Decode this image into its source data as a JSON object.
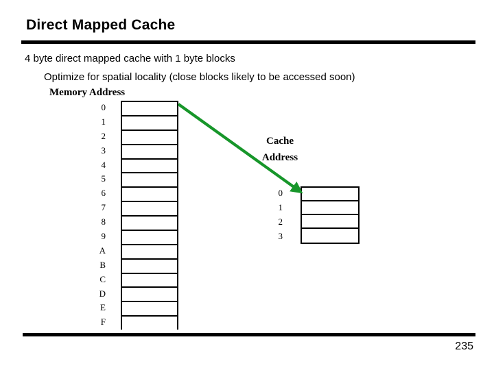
{
  "slide": {
    "title": "Direct Mapped Cache",
    "page_number": "235",
    "accent_color": "#17962a",
    "rule_color": "#000000",
    "background": "#ffffff"
  },
  "body": {
    "line_1": "4 byte direct mapped cache with 1 byte blocks",
    "line_2": "Optimize for spatial locality (close blocks likely to be accessed soon)"
  },
  "memory": {
    "label": "Memory Address",
    "indices": [
      "0",
      "1",
      "2",
      "3",
      "4",
      "5",
      "6",
      "7",
      "8",
      "9",
      "A",
      "B",
      "C",
      "D",
      "E",
      "F"
    ],
    "cells": [
      "",
      "",
      "",
      "",
      "",
      "",
      "",
      "",
      "",
      "",
      "",
      "",
      "",
      "",
      "",
      ""
    ]
  },
  "cache": {
    "label_line_1": "Cache",
    "label_line_2": "Address",
    "indices": [
      "0",
      "1",
      "2",
      "3"
    ],
    "cells": [
      "",
      "",
      "",
      ""
    ]
  },
  "arrow": {
    "name": "memory-to-cache-mapping-arrow",
    "color": "#17962a",
    "from": "memory block 0",
    "to": "cache block 0"
  }
}
